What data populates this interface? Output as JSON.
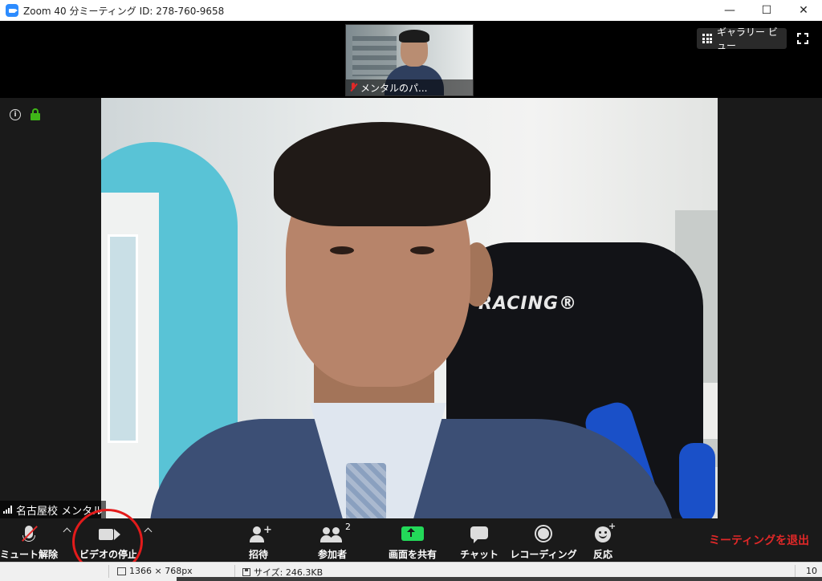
{
  "window": {
    "title": "Zoom 40 分ミーティング ID: 278-760-9658",
    "minimize": "—",
    "maximize": "☐",
    "close": "✕"
  },
  "thumbnail": {
    "name": "メンタルのパ..."
  },
  "view": {
    "gallery_label": "ギャラリー ビュー"
  },
  "main_video": {
    "logo_text": "RACING®",
    "name": "名古屋校 メンタル"
  },
  "toolbar": {
    "unmute_label": "ミュート解除",
    "stop_video_label": "ビデオの停止",
    "invite_label": "招待",
    "participants_label": "参加者",
    "participants_count": "2",
    "share_label": "画面を共有",
    "chat_label": "チャット",
    "record_label": "レコーディング",
    "reactions_label": "反応",
    "leave_label": "ミーティングを退出"
  },
  "statusbar": {
    "dimensions": "1366 × 768px",
    "size": "サイズ: 246.3KB",
    "zoom": "10"
  },
  "colors": {
    "accent_green": "#23d959",
    "leave_red": "#e02828",
    "annotation_red": "#e31b1b",
    "zoom_blue": "#2d8cff"
  }
}
